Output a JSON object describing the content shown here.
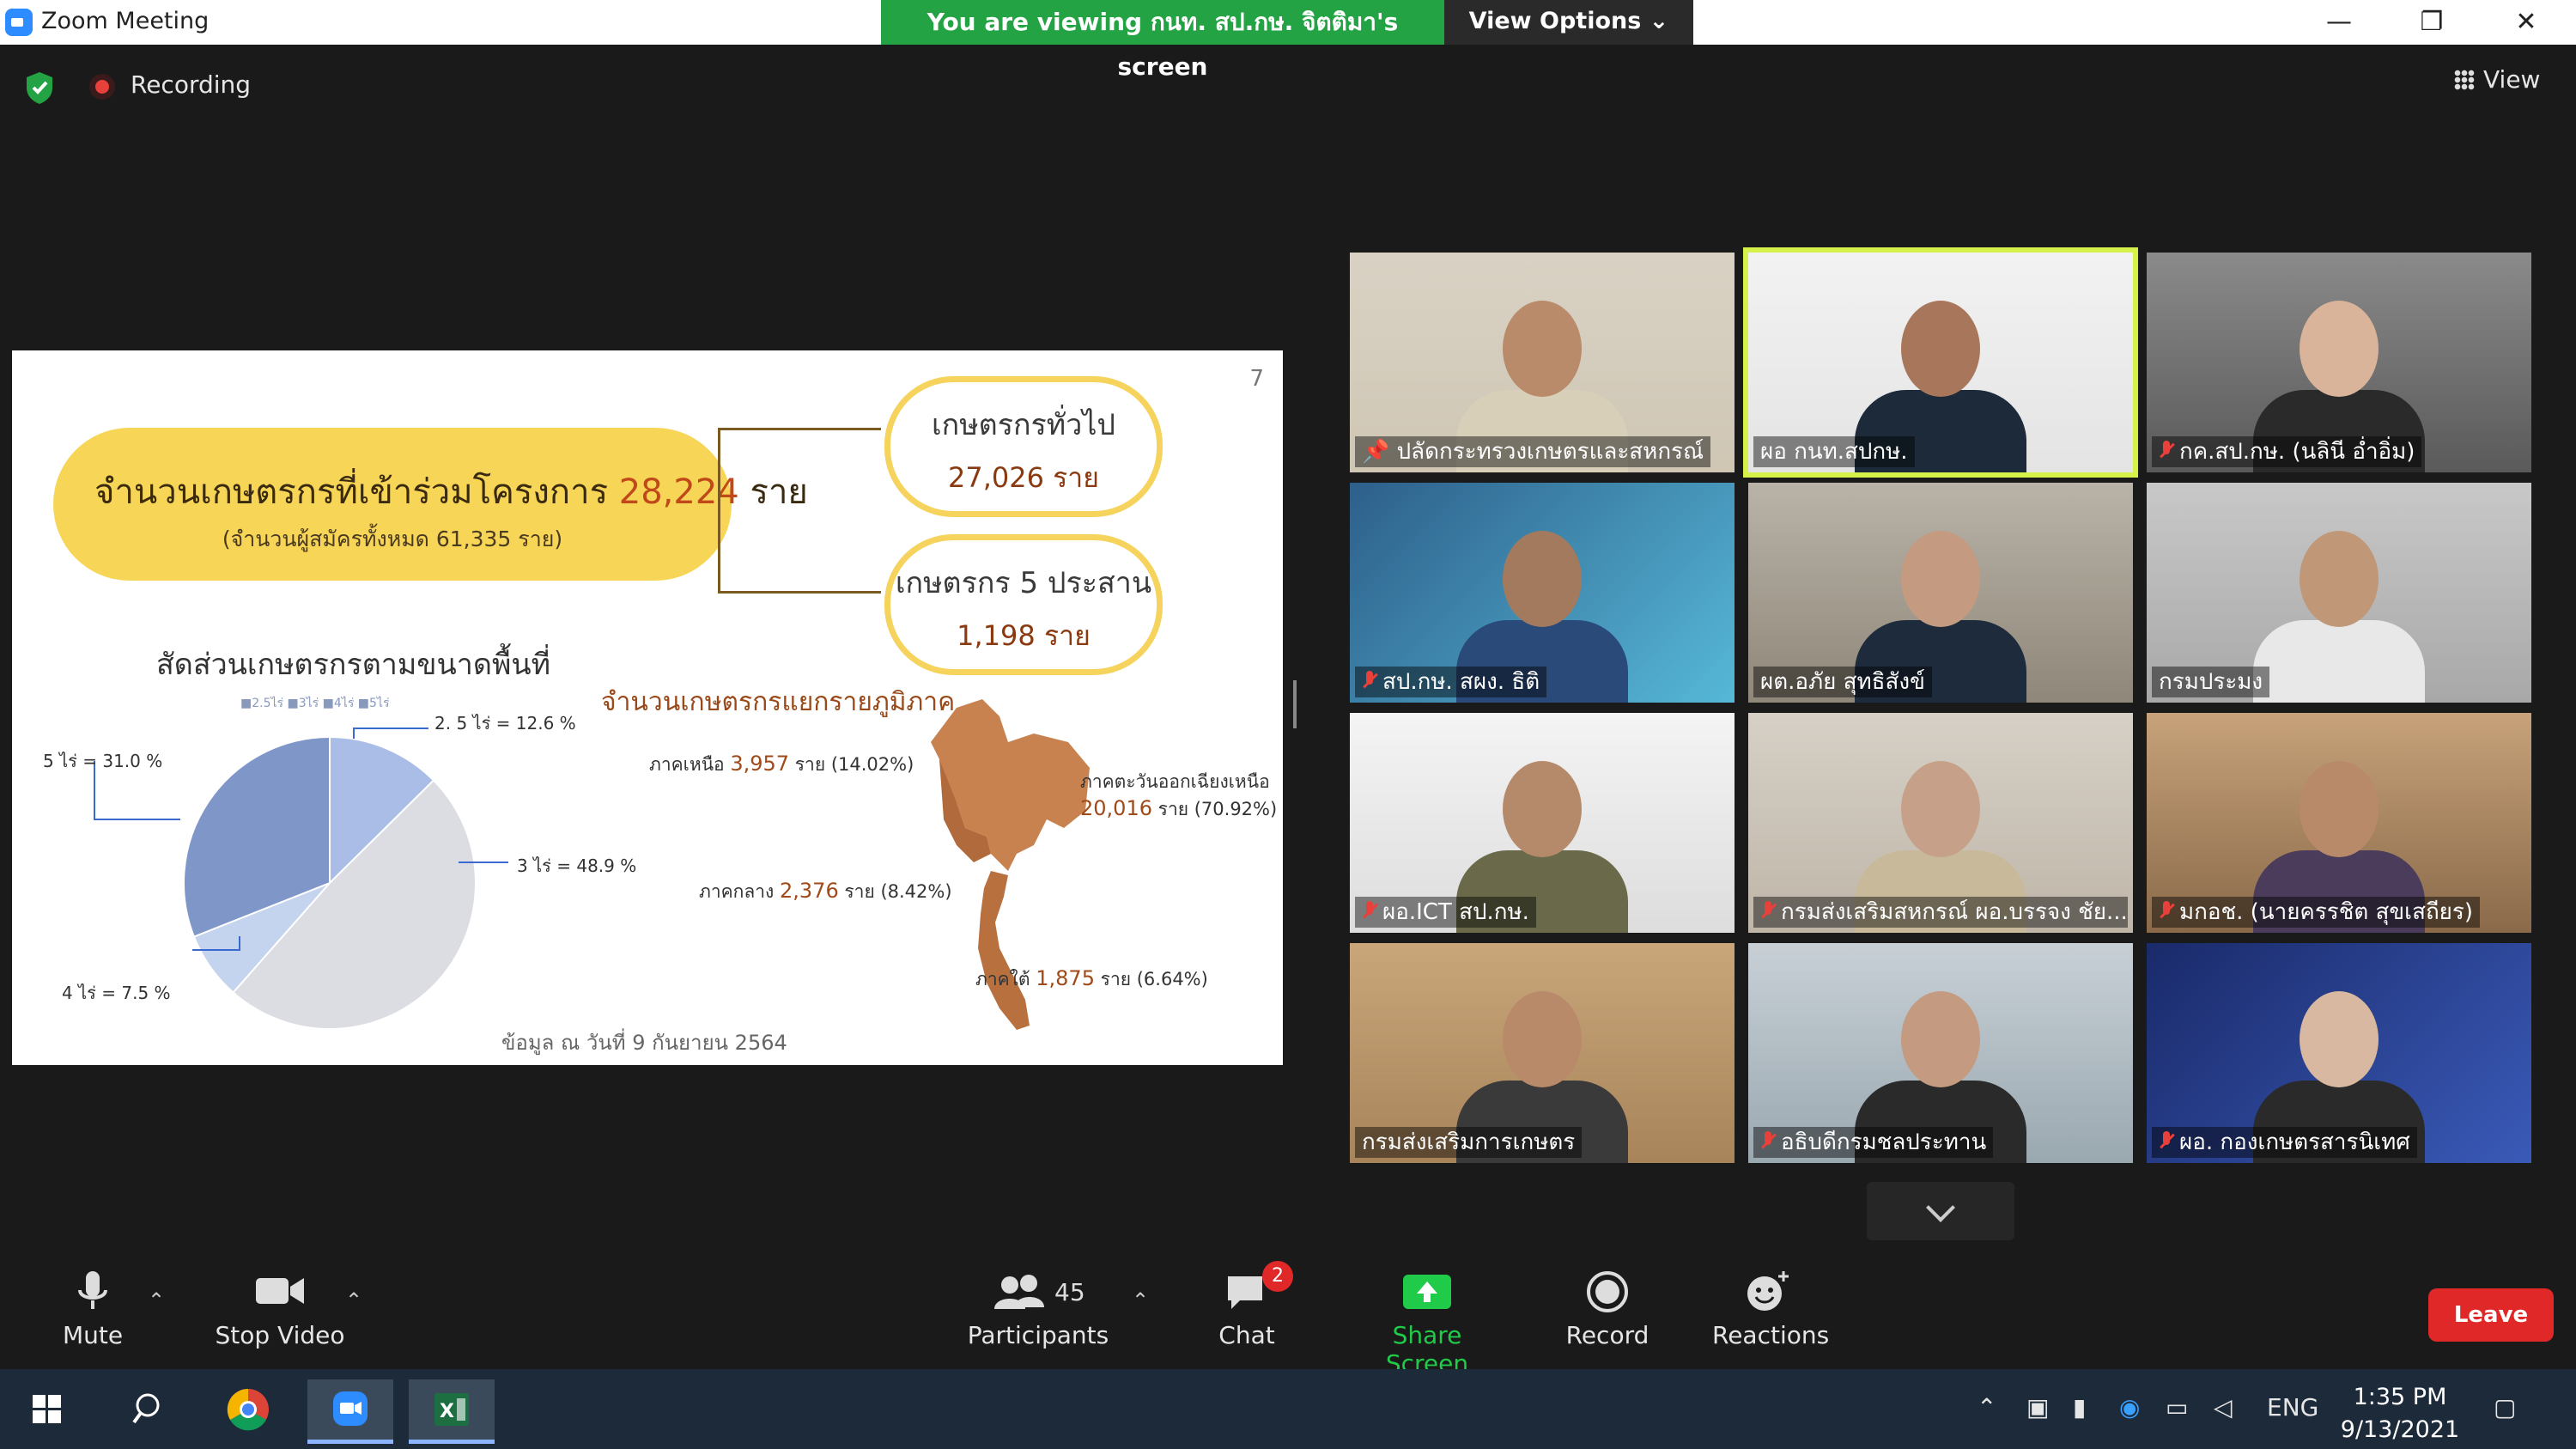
{
  "window": {
    "title": "Zoom Meeting",
    "minimize": "—",
    "maximize": "❐",
    "close": "✕"
  },
  "share_banner": {
    "text": "You are viewing กนท. สป.กษ. จิตติมา's screen",
    "view_options": "View Options ⌄"
  },
  "top_bar": {
    "recording_label": "Recording",
    "view_label": "View"
  },
  "slide": {
    "page_number": "7",
    "main_title": "จำนวนเกษตรกรที่เข้าร่วมโครงการ",
    "main_count": "28,224",
    "main_unit": "ราย",
    "main_sub": "(จำนวนผู้สมัครทั้งหมด 61,335 ราย)",
    "box1_title": "เกษตรกรทั่วไป",
    "box1_value": "27,026 ราย",
    "box2_title": "เกษตรกร 5 ประสาน",
    "box2_value": "1,198 ราย",
    "pie_title": "สัดส่วนเกษตรกรตามขนาดพื้นที่",
    "pie_legend": "■2.5ไร่  ■3ไร่  ■4ไร่  ■5ไร่",
    "pie_labels": {
      "l25": "2. 5 ไร่ = 12.6 %",
      "l3": "3 ไร่ = 48.9 %",
      "l4": "4 ไร่ = 7.5 %",
      "l5": "5 ไร่ = 31.0 %"
    },
    "region_title": "จำนวนเกษตรกรแยกรายภูมิภาค",
    "regions": {
      "north_label": "ภาคเหนือ",
      "north_value": "3,957",
      "north_rest": "ราย (14.02%)",
      "ne_label": "ภาคตะวันออกเฉียงเหนือ",
      "ne_value": "20,016",
      "ne_rest": "ราย (70.92%)",
      "central_label": "ภาคกลาง",
      "central_value": "2,376",
      "central_rest": "ราย (8.42%)",
      "south_label": "ภาคใต้",
      "south_value": "1,875",
      "south_rest": "ราย (6.64%)"
    },
    "footnote": "ข้อมูล ณ วันที่ 9 กันยายน 2564"
  },
  "chart_data": {
    "type": "pie",
    "title": "สัดส่วนเกษตรกรตามขนาดพื้นที่",
    "categories": [
      "2.5ไร่",
      "3ไร่",
      "4ไร่",
      "5ไร่"
    ],
    "values": [
      12.6,
      48.9,
      7.5,
      31.0
    ],
    "colors": [
      "#a9bde6",
      "#dcdde3",
      "#c4d4ef",
      "#7f96c9"
    ]
  },
  "participants_tiles": [
    {
      "name": "ปลัดกระทรวงเกษตรและสหกรณ์",
      "pinned": true,
      "muted": false
    },
    {
      "name": "ผอ กนท.สปกษ.",
      "pinned": false,
      "muted": false,
      "active_speaker": true
    },
    {
      "name": "กค.สป.กษ. (นลินี อ่ำอิ่ม)",
      "pinned": false,
      "muted": true
    },
    {
      "name": "สป.กษ. สผง. ธิติ",
      "pinned": false,
      "muted": true
    },
    {
      "name": "ผต.อภัย สุทธิสังข์",
      "pinned": false,
      "muted": false
    },
    {
      "name": "กรมประมง",
      "pinned": false,
      "muted": false
    },
    {
      "name": "ผอ.ICT สป.กษ.",
      "pinned": false,
      "muted": true
    },
    {
      "name": "กรมส่งเสริมสหกรณ์ ผอ.บรรจง ชัย...",
      "pinned": false,
      "muted": true
    },
    {
      "name": "มกอช. (นายครรชิต สุขเสถียร)",
      "pinned": false,
      "muted": true
    },
    {
      "name": "กรมส่งเสริมการเกษตร",
      "pinned": false,
      "muted": false
    },
    {
      "name": "อธิบดีกรมชลประทาน",
      "pinned": false,
      "muted": true
    },
    {
      "name": "ผอ. กองเกษตรสารนิเทศ",
      "pinned": false,
      "muted": true
    }
  ],
  "toolbar": {
    "mute": "Mute",
    "stop_video": "Stop Video",
    "participants": "Participants",
    "participants_count": "45",
    "chat": "Chat",
    "chat_badge": "2",
    "share_screen": "Share Screen",
    "record": "Record",
    "reactions": "Reactions",
    "leave": "Leave"
  },
  "taskbar": {
    "language": "ENG",
    "time": "1:35 PM",
    "date": "9/13/2021"
  },
  "colors": {
    "share_green": "#23a343",
    "leave_red": "#e02828",
    "active_speaker": "#d6f24a",
    "slide_yellow": "#f7d557"
  }
}
